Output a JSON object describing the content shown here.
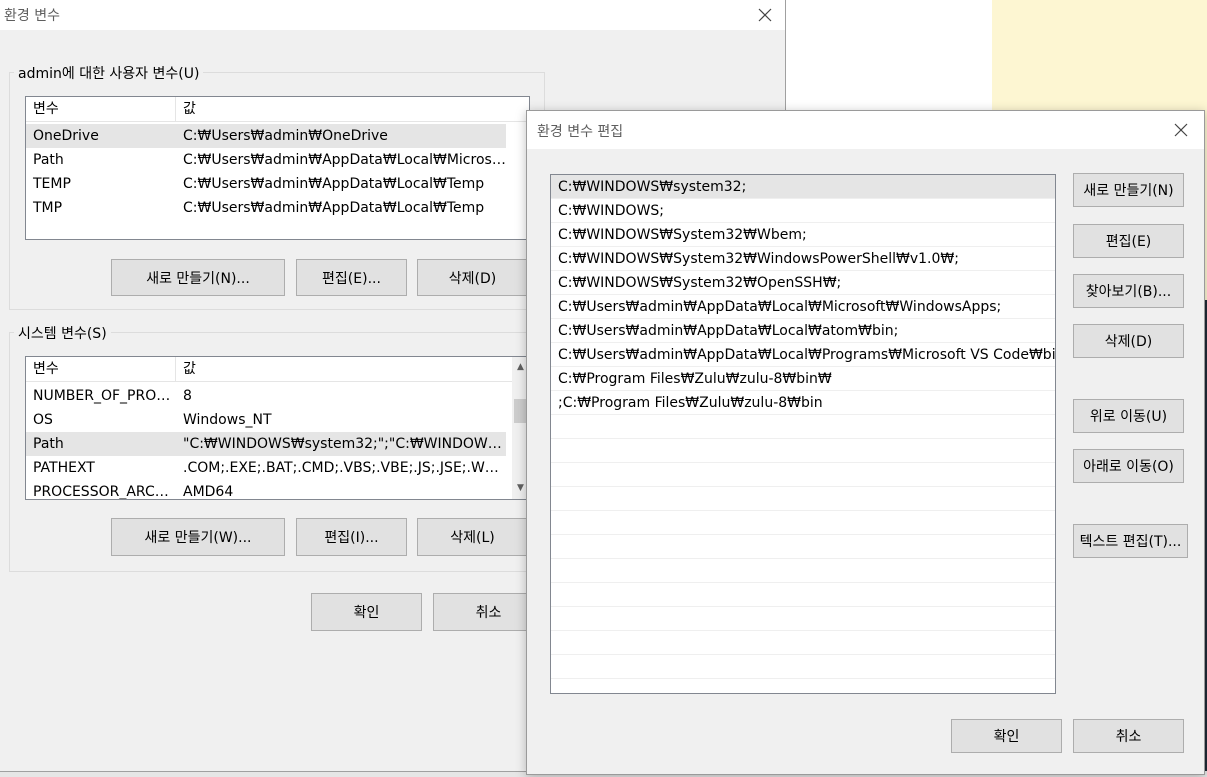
{
  "main_dialog": {
    "title": "환경 변수",
    "user_group_label": "admin에 대한 사용자 변수(U)",
    "system_group_label": "시스템 변수(S)",
    "columns": [
      "변수",
      "값"
    ],
    "user_vars": [
      {
        "name": "OneDrive",
        "value": "C:₩Users₩admin₩OneDrive"
      },
      {
        "name": "Path",
        "value": "C:₩Users₩admin₩AppData₩Local₩Microsoft..."
      },
      {
        "name": "TEMP",
        "value": "C:₩Users₩admin₩AppData₩Local₩Temp"
      },
      {
        "name": "TMP",
        "value": "C:₩Users₩admin₩AppData₩Local₩Temp"
      }
    ],
    "system_vars": [
      {
        "name": "NUMBER_OF_PROC...",
        "value": "8"
      },
      {
        "name": "OS",
        "value": "Windows_NT"
      },
      {
        "name": "Path",
        "value": "\"C:₩WINDOWS₩system32;\";\"C:₩WINDOWS;\";..."
      },
      {
        "name": "PATHEXT",
        "value": ".COM;.EXE;.BAT;.CMD;.VBS;.VBE;.JS;.JSE;.WSF;...."
      },
      {
        "name": "PROCESSOR_ARCH...",
        "value": "AMD64"
      }
    ],
    "user_buttons": {
      "new": "새로 만들기(N)...",
      "edit": "편집(E)...",
      "delete": "삭제(D)"
    },
    "system_buttons": {
      "new": "새로 만들기(W)...",
      "edit": "편집(I)...",
      "delete": "삭제(L)"
    },
    "ok": "확인",
    "cancel": "취소"
  },
  "edit_dialog": {
    "title": "환경 변수 편집",
    "paths": [
      "C:₩WINDOWS₩system32;",
      "C:₩WINDOWS;",
      "C:₩WINDOWS₩System32₩Wbem;",
      "C:₩WINDOWS₩System32₩WindowsPowerShell₩v1.0₩;",
      "C:₩WINDOWS₩System32₩OpenSSH₩;",
      "C:₩Users₩admin₩AppData₩Local₩Microsoft₩WindowsApps;",
      "C:₩Users₩admin₩AppData₩Local₩atom₩bin;",
      "C:₩Users₩admin₩AppData₩Local₩Programs₩Microsoft VS Code₩bin;",
      "C:₩Program Files₩Zulu₩zulu-8₩bin₩",
      ";C:₩Program Files₩Zulu₩zulu-8₩bin"
    ],
    "buttons": {
      "new": "새로 만들기(N)",
      "edit": "편집(E)",
      "browse": "찾아보기(B)...",
      "delete": "삭제(D)",
      "move_up": "위로 이동(U)",
      "move_down": "아래로 이동(O)",
      "edit_text": "텍스트 편집(T)..."
    },
    "ok": "확인",
    "cancel": "취소"
  }
}
